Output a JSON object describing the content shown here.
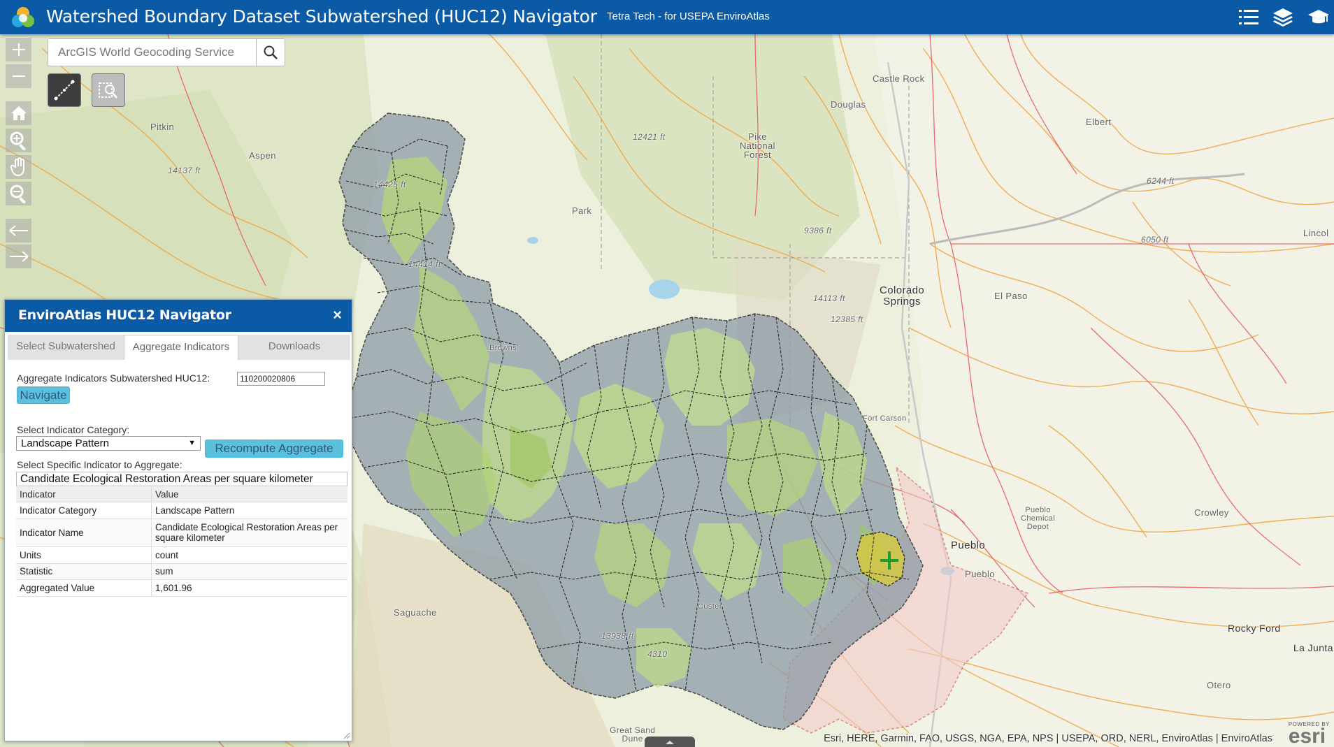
{
  "header": {
    "title": "Watershed Boundary Dataset Subwatershed (HUC12) Navigator",
    "subtitle": "Tetra Tech - for USEPA EnviroAtlas",
    "icons": [
      "list-icon",
      "layers-icon",
      "graduation-cap-icon"
    ],
    "color": "#0a5aa6"
  },
  "search": {
    "placeholder": "ArcGIS World Geocoding Service"
  },
  "map": {
    "labels": {
      "castle_rock": "Castle Rock",
      "douglas": "Douglas",
      "elbert": "Elbert",
      "pike_nf": "Pike\nNational\nForest",
      "aspen": "Aspen",
      "pitkin": "Pitkin",
      "park": "Park",
      "colorado_springs": "Colorado\nSprings",
      "el_paso": "El Paso",
      "lincoln": "Lincol",
      "fort_carson": "Fort Carson",
      "pueblo_city": "Pueblo",
      "pueblo_county": "Pueblo",
      "pueblo_depot": "Pueblo\nChemical\nDepot",
      "crowley": "Crowley",
      "rocky_ford": "Rocky Ford",
      "la_junta": "La Junta",
      "otero": "Otero",
      "saguache": "Saguache",
      "custer": "Custer",
      "great_sand_dunes": "Great Sand\nDune",
      "browns": "Browns",
      "elev_14137": "14137 ft",
      "elev_12421": "12421 ft",
      "elev_9386": "9386 ft",
      "elev_6244": "6244 ft",
      "elev_6050": "6050 ft",
      "elev_14113": "14113 ft",
      "elev_12385": "12385 ft",
      "elev_13938": "13938 ft",
      "elev_14425": "14425 ft",
      "elev_14414": "14414 ft",
      "elev_4310": "4310"
    }
  },
  "panel": {
    "title": "EnviroAtlas HUC12 Navigator",
    "close": "×",
    "tabs": [
      "Select Subwatershed",
      "Aggregate Indicators",
      "Downloads"
    ],
    "active_tab": "Aggregate Indicators",
    "huc_label": "Aggregate Indicators Subwatershed HUC12:",
    "huc_value": "110200020806",
    "navigate_label": "Navigate",
    "category_label": "Select Indicator Category:",
    "category_value": "Landscape Pattern",
    "recompute_label": "Recompute Aggregate",
    "specific_label": "Select Specific Indicator to Aggregate:",
    "specific_value": "Candidate Ecological Restoration Areas per square kilometer",
    "table": {
      "headers": [
        "Indicator",
        "Value"
      ],
      "rows": [
        {
          "k": "Indicator Category",
          "v": "Landscape Pattern"
        },
        {
          "k": "Indicator Name",
          "v": "Candidate Ecological Restoration Areas per square kilometer"
        },
        {
          "k": "Units",
          "v": "count"
        },
        {
          "k": "Statistic",
          "v": "sum"
        },
        {
          "k": "Aggregated Value",
          "v": "1,601.96"
        }
      ]
    }
  },
  "attribution": "Esri, HERE, Garmin, FAO, USGS, NGA, EPA, NPS | USEPA, ORD, NERL, EnviroAtlas | EnviroAtlas",
  "esri_logo": {
    "powered": "POWERED BY",
    "name": "esri"
  }
}
